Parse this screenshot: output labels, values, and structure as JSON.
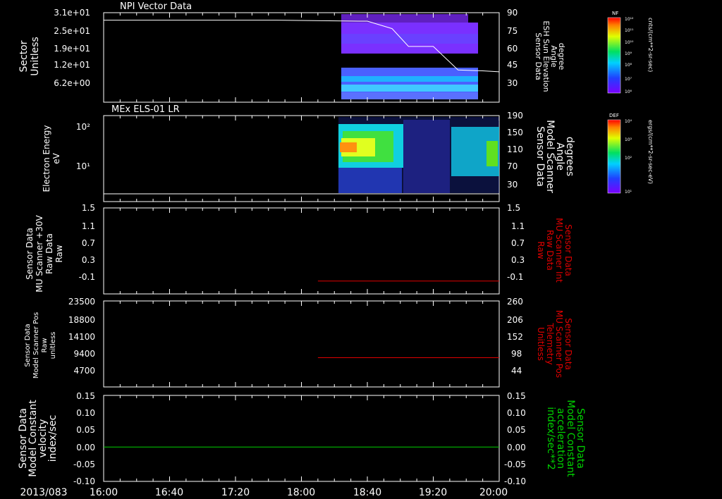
{
  "colors": {
    "axis": "#ffffff",
    "red": "#e00000",
    "green": "#00d000"
  },
  "time_axis": {
    "date_label": "2013/083",
    "ticks": [
      "16:00",
      "16:40",
      "17:20",
      "18:00",
      "18:40",
      "19:20",
      "20:00"
    ],
    "range_minutes": [
      0,
      240
    ]
  },
  "colorbars": [
    {
      "name": "nf-colorbar",
      "title": "NF",
      "units": "cnts/(cm**2-sr-sec)",
      "ticks": [
        "10¹²",
        "10¹¹",
        "10¹⁰",
        "10⁹",
        "10⁸",
        "10⁷",
        "10⁶"
      ]
    },
    {
      "name": "def-colorbar",
      "title": "DEF",
      "units": "ergs/(cm**2-sr-sec-eV)",
      "ticks": [
        "10⁴",
        "10³",
        "10²",
        "10¹"
      ]
    }
  ],
  "chart_data": [
    {
      "id": "panel1",
      "type": "heatmap",
      "title": "NPI Vector Data",
      "ylabel_left": [
        "Sector",
        "Unitless"
      ],
      "ylabel_right": [
        "Sensor Data",
        "ESH Sun Elevation",
        "Angle",
        "degree"
      ],
      "yticks_left": [
        "3.1e+01",
        "2.5e+01",
        "1.9e+01",
        "1.2e+01",
        "6.2e+00"
      ],
      "yticks_right": [
        "90",
        "75",
        "60",
        "45",
        "30"
      ],
      "line": {
        "series_axis": "right",
        "x_minutes": [
          0,
          105,
          155,
          160,
          175,
          185,
          200,
          215,
          230,
          240
        ],
        "values": [
          82,
          82,
          81,
          81,
          73,
          54,
          54,
          29,
          28,
          27
        ]
      }
    },
    {
      "id": "panel2",
      "type": "heatmap",
      "title": "MEx ELS-01 LR",
      "ylabel_left": [
        "Electron Energy",
        "eV"
      ],
      "ylabel_right": [
        "Sensor Data",
        "Model Scanner",
        "Angle",
        "degrees"
      ],
      "yticks_left": [
        "10²",
        "10¹"
      ],
      "yticks_right": [
        "190",
        "150",
        "110",
        "70",
        "30"
      ],
      "line": {
        "series_axis": "right",
        "x_minutes": [
          0,
          240
        ],
        "values": [
          4,
          4
        ]
      }
    },
    {
      "id": "panel3",
      "type": "line",
      "ylabel_left": [
        "Sensor Data",
        "MU Scanner +30V",
        "Raw Data",
        "Raw"
      ],
      "ylabel_right": [
        "Sensor Data",
        "MU Scanner Int",
        "Raw Data",
        "Raw"
      ],
      "yticks_left": [
        "1.5",
        "1.1",
        "0.7",
        "0.3",
        "-0.1"
      ],
      "yticks_right": [
        "1.5",
        "1.1",
        "0.7",
        "0.3",
        "-0.1"
      ],
      "ylim": [
        -0.3,
        1.5
      ],
      "series": [
        {
          "x_minutes": [
            130,
            240
          ],
          "values": [
            -0.03,
            -0.03
          ]
        }
      ]
    },
    {
      "id": "panel4",
      "type": "line",
      "ylabel_left": [
        "Sensor Data",
        "Model Scanner Pos",
        "Raw",
        "unitless"
      ],
      "ylabel_right": [
        "Sensor Data",
        "MU Scanner Pos",
        "Telemetry",
        "Unitless"
      ],
      "yticks_left": [
        "23500",
        "18800",
        "14100",
        "9400",
        "4700"
      ],
      "yticks_right": [
        "260",
        "206",
        "152",
        "98",
        "44"
      ],
      "ylim": [
        0,
        23500
      ],
      "series": [
        {
          "x_minutes": [
            130,
            240
          ],
          "values": [
            8000,
            8000
          ]
        }
      ]
    },
    {
      "id": "panel5",
      "type": "line",
      "ylabel_left": [
        "Sensor Data",
        "Model Constant",
        "velocity",
        "index/sec"
      ],
      "ylabel_right": [
        "Sensor Data",
        "Model Constant",
        "acceleration",
        "index/sec**2"
      ],
      "yticks_left": [
        "0.15",
        "0.10",
        "0.05",
        "0.00",
        "-0.05",
        "-0.10"
      ],
      "yticks_right": [
        "0.15",
        "0.10",
        "0.05",
        "0.00",
        "-0.05",
        "-0.10"
      ],
      "ylim": [
        -0.1,
        0.15
      ],
      "series": [
        {
          "x_minutes": [
            0,
            240
          ],
          "values": [
            0,
            0
          ]
        }
      ]
    }
  ]
}
